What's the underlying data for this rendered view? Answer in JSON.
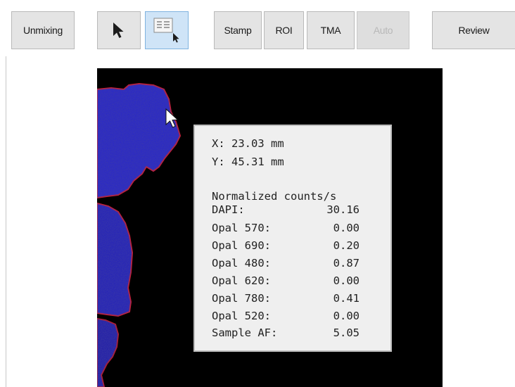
{
  "toolbar": {
    "unmixing": "Unmixing",
    "stamp": "Stamp",
    "roi": "ROI",
    "tma": "TMA",
    "auto": "Auto",
    "review": "Review"
  },
  "icons": {
    "select": "pointer-arrow-icon",
    "inspect": "pixel-readout-icon"
  },
  "colors": {
    "button_bg": "#e4e4e4",
    "active_bg": "#cfe4f7",
    "viewer_bg": "#000000",
    "tissue_nuclei": "#2b2bd6",
    "tissue_edge": "#d0203a"
  },
  "readout": {
    "x_label": "X:",
    "x_value": "23.03",
    "x_unit": "mm",
    "y_label": "Y:",
    "y_value": "45.31",
    "y_unit": "mm",
    "heading": "Normalized counts/s",
    "channels": [
      {
        "name": "DAPI:",
        "value": "30.16"
      },
      {
        "name": "Opal 570:",
        "value": "0.00"
      },
      {
        "name": "Opal 690:",
        "value": "0.20"
      },
      {
        "name": "Opal 480:",
        "value": "0.87"
      },
      {
        "name": "Opal 620:",
        "value": "0.00"
      },
      {
        "name": "Opal 780:",
        "value": "0.41"
      },
      {
        "name": "Opal 520:",
        "value": "0.00"
      },
      {
        "name": "Sample AF:",
        "value": "5.05"
      }
    ]
  }
}
